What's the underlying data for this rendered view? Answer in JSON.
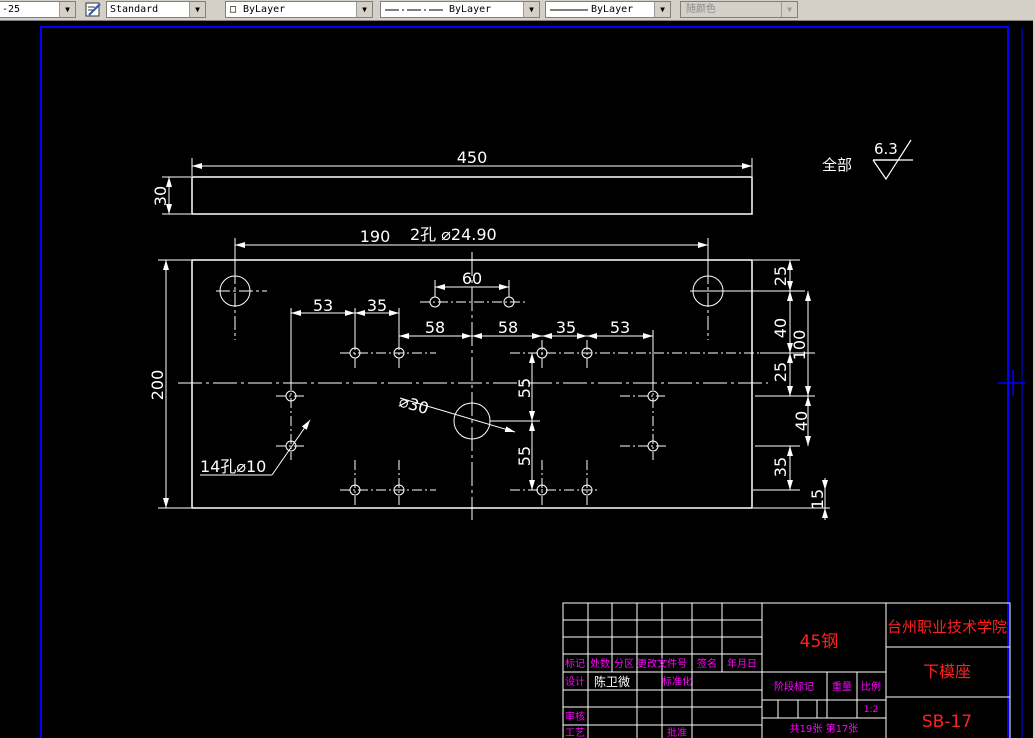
{
  "toolbar": {
    "dimstyle_value": "-25",
    "textstyle_value": "Standard",
    "layer_color_value": "ByLayer",
    "linetype_value": "ByLayer",
    "lineweight_value": "ByLayer",
    "plotstyle_value": "随颜色"
  },
  "drawing": {
    "roughness_prefix": "全部",
    "roughness_value": "6.3",
    "dim_450": "450",
    "dim_30": "30",
    "dim_190": "190",
    "dim_2holes": "2孔  ⌀24.90",
    "dim_60": "60",
    "dim_53_left": "53",
    "dim_35_left": "35",
    "dim_58_left": "58",
    "dim_58_right": "58",
    "dim_35_right": "35",
    "dim_53_right": "53",
    "dim_200": "200",
    "dim_25_top": "25",
    "dim_40_top": "40",
    "dim_100": "100",
    "dim_25_mid": "25",
    "dim_40_low": "40",
    "dim_35_low": "35",
    "dim_15": "15",
    "dim_55_top": "55",
    "dim_55_bottom": "55",
    "dim_dia30": "⌀30",
    "dim_14holes": "14孔⌀10"
  },
  "titleblock": {
    "material": "45钢",
    "school": "台州职业技术学院",
    "part_name": "下模座",
    "drawing_no": "SB-17",
    "h_mark": "标记",
    "h_count": "处数",
    "h_zone": "分区",
    "h_change_doc": "更改文件号",
    "h_sign": "签名",
    "h_date": "年月日",
    "h_design": "设计",
    "designer": "陈卫微",
    "h_standard": "标准化",
    "h_stage": "阶段标记",
    "h_weight": "重量",
    "h_scale": "比例",
    "scale": "1:2",
    "h_review": "审核",
    "h_process": "工艺",
    "h_approve": "批准",
    "sheets": "共19张  第17张"
  },
  "colors": {
    "background": "#000000",
    "geometry": "#ffffff",
    "frame": "#0000ff",
    "titleblock_red": "#ff2020",
    "titleblock_magenta": "#ff00ff"
  }
}
